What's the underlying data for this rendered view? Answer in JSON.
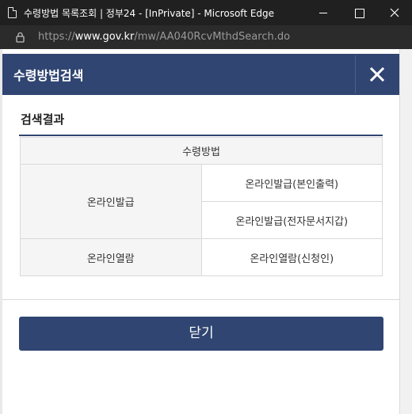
{
  "window": {
    "title": "수령방법 목록조회 | 정부24 - [InPrivate] - Microsoft Edge"
  },
  "address_bar": {
    "scheme": "https://",
    "host": "www.gov.kr",
    "path": "/mw/AA040RcvMthdSearch.do"
  },
  "popup": {
    "title": "수령방법검색",
    "section_title": "검색결과",
    "table": {
      "header": "수령방법",
      "groups": [
        {
          "name": "온라인발급",
          "methods": [
            "온라인발급(본인출력)",
            "온라인발급(전자문서지갑)"
          ]
        },
        {
          "name": "온라인열람",
          "methods": [
            "온라인열람(신청인)"
          ]
        }
      ]
    },
    "close_button_label": "닫기"
  },
  "colors": {
    "header_navy": "#304571",
    "table_head_bg": "#f5f5f5",
    "titlebar_bg": "#202020",
    "addressbar_bg": "#2b2b2b"
  },
  "icons": [
    "page-icon",
    "minimize-icon",
    "maximize-icon",
    "window-close-icon",
    "lock-icon",
    "close-x-icon"
  ]
}
